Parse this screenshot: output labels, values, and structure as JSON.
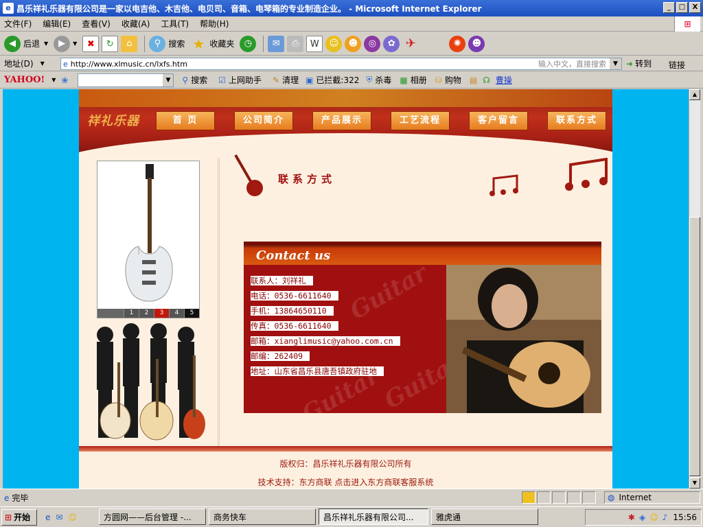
{
  "window": {
    "title": "昌乐祥礼乐器有限公司是一家以电吉他、木吉他、电贝司、音箱、电琴箱的专业制造企业。 - Microsoft Internet Explorer",
    "controls": [
      "_",
      "□",
      "X"
    ]
  },
  "menu": [
    "文件(F)",
    "编辑(E)",
    "查看(V)",
    "收藏(A)",
    "工具(T)",
    "帮助(H)"
  ],
  "toolbar": {
    "back_label": "后退",
    "search_label": "搜索",
    "favorites_label": "收藏夹"
  },
  "address": {
    "label": "地址(D)",
    "url": "http://www.xlmusic.cn/lxfs.htm",
    "search_hint": "输入中文，直接搜索",
    "go_label": "转到",
    "links_label": "链接"
  },
  "yahoo_bar": {
    "logo": "YAHOO!",
    "items": [
      "搜索",
      "上网助手",
      "清理",
      "已拦截:322",
      "杀毒",
      "相册",
      "购物",
      "曹操"
    ]
  },
  "site": {
    "logo": "祥礼乐器",
    "nav": [
      "首 页",
      "公司简介",
      "产品展示",
      "工艺流程",
      "客户留言",
      "联系方式"
    ],
    "pager": [
      "1",
      "2",
      "3",
      "4",
      "5"
    ],
    "pager_active": 2,
    "section_title": "联系方式",
    "card_title": "Contact us",
    "watermark": "Guitar",
    "contact": [
      {
        "label": "联系人：",
        "value": "刘祥礼"
      },
      {
        "label": "电话：",
        "value": "0536-6611640"
      },
      {
        "label": "手机：",
        "value": "13864650110"
      },
      {
        "label": "传真：",
        "value": "0536-6611640"
      },
      {
        "label": "邮箱：",
        "value": "xianglimusic@yahoo.com.cn"
      },
      {
        "label": "邮编：",
        "value": "262409"
      },
      {
        "label": "地址：",
        "value": "山东省昌乐县唐吾镇政府驻地"
      }
    ],
    "footer_copyright": "版权归：昌乐祥礼乐器有限公司所有",
    "footer_support": "技术支持：东方商联 点击进入东方商联客服系统"
  },
  "status": {
    "text": "完毕",
    "zone": "Internet"
  },
  "taskbar": {
    "start": "开始",
    "tasks": [
      "方圆网——后台管理 -...",
      "商务快车",
      "昌乐祥礼乐器有限公司...",
      "雅虎通"
    ],
    "active_task": 2,
    "clock": "15:56"
  },
  "colors": {
    "title_bar": "#1d4fc0",
    "viewport_bg": "#00b4f0",
    "brand_red": "#a11010",
    "nav_orange": "#e67c20",
    "page_bg": "#fdf0e0"
  }
}
